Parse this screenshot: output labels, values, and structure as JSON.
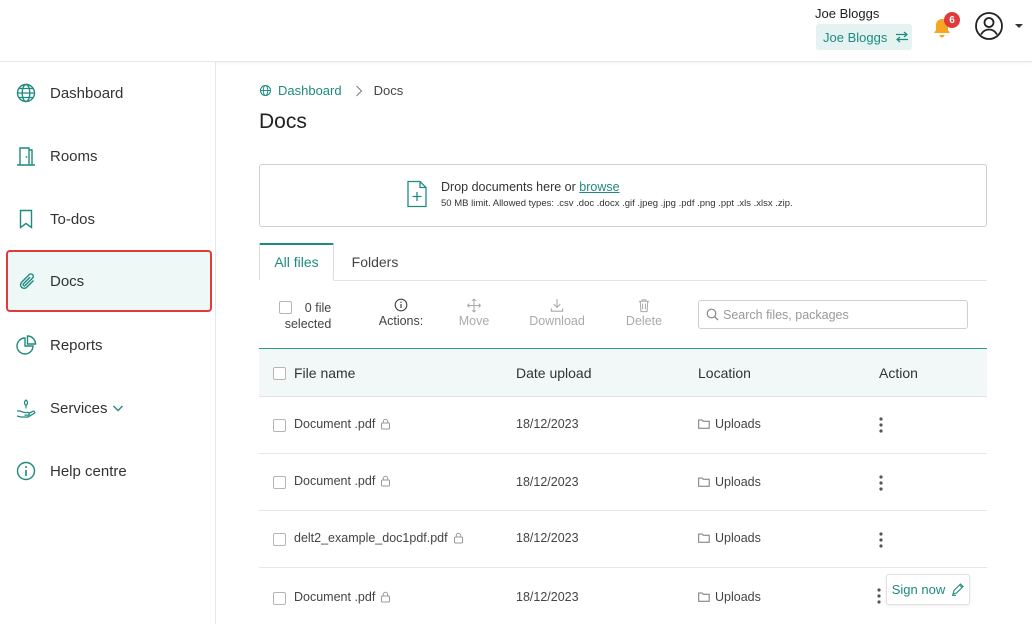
{
  "header": {
    "user_name": "Joe Bloggs",
    "account_switch_label": "Joe Bloggs",
    "notification_count": "6"
  },
  "sidebar": {
    "items": [
      {
        "label": "Dashboard",
        "icon": "globe-icon"
      },
      {
        "label": "Rooms",
        "icon": "door-icon"
      },
      {
        "label": "To-dos",
        "icon": "bookmark-icon"
      },
      {
        "label": "Docs",
        "icon": "paperclip-icon",
        "active": true
      },
      {
        "label": "Reports",
        "icon": "pie-chart-icon"
      },
      {
        "label": "Services",
        "icon": "hand-icon"
      },
      {
        "label": "Help centre",
        "icon": "info-icon"
      }
    ]
  },
  "breadcrumb": {
    "home": "Dashboard",
    "current": "Docs"
  },
  "page_title": "Docs",
  "dropzone": {
    "text": "Drop documents here or",
    "link": "browse",
    "limits": "50 MB limit. Allowed types: .csv .doc .docx .gif .jpeg .jpg .pdf .png .ppt .xls .xlsx .zip."
  },
  "tabs": [
    "All files",
    "Folders"
  ],
  "toolbar": {
    "selected_line1": "0 file",
    "selected_line2": "selected",
    "actions_label": "Actions:",
    "move": "Move",
    "download": "Download",
    "delete": "Delete",
    "search_placeholder": "Search files, packages"
  },
  "table": {
    "columns": [
      "File name",
      "Date upload",
      "Location",
      "Action"
    ],
    "rows": [
      {
        "name": "Document .pdf",
        "date": "18/12/2023",
        "location": "Uploads"
      },
      {
        "name": "Document .pdf",
        "date": "18/12/2023",
        "location": "Uploads"
      },
      {
        "name": "delt2_example_doc1pdf.pdf",
        "date": "18/12/2023",
        "location": "Uploads"
      },
      {
        "name": "Document .pdf",
        "date": "18/12/2023",
        "location": "Uploads",
        "sign_label": "Sign now"
      }
    ]
  },
  "colors": {
    "accent": "#1f8a80",
    "badge": "#e03a3a",
    "bell": "#f5a623",
    "highlight": "#e03a3a"
  }
}
